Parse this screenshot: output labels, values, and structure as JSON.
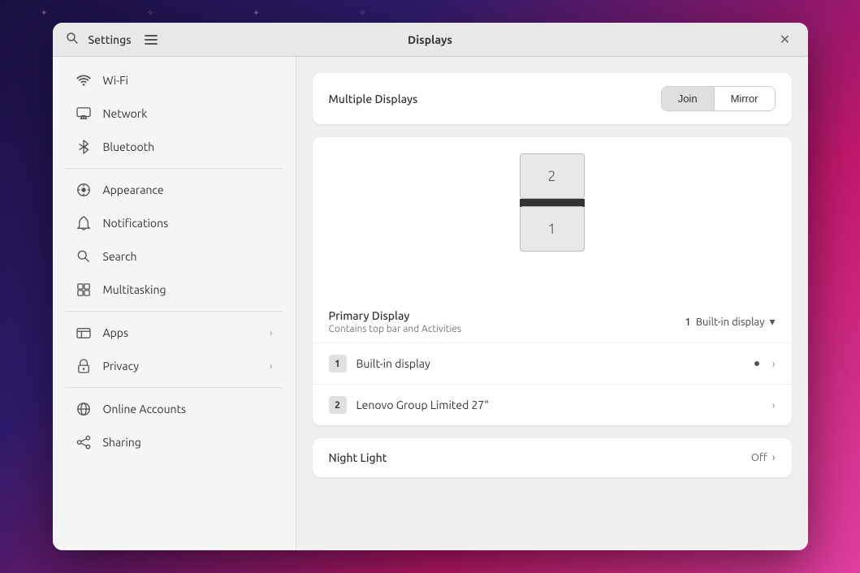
{
  "window": {
    "title": "Displays",
    "settings_label": "Settings"
  },
  "multiple_displays": {
    "label": "Multiple Displays",
    "btn_join": "Join",
    "btn_mirror": "Mirror"
  },
  "display_preview": {
    "display1_num": "1",
    "display2_num": "2"
  },
  "primary_display": {
    "title": "Primary Display",
    "subtitle": "Contains top bar and Activities",
    "monitor_num": "1",
    "display_type": "Built-in display"
  },
  "display_list": [
    {
      "num": "1",
      "name": "Built-in display"
    },
    {
      "num": "2",
      "name": "Lenovo Group Limited 27\""
    }
  ],
  "night_light": {
    "label": "Night Light",
    "status": "Off"
  },
  "sidebar": {
    "items": [
      {
        "id": "wifi",
        "label": "Wi-Fi",
        "icon": "📶",
        "has_arrow": false
      },
      {
        "id": "network",
        "label": "Network",
        "icon": "🖥",
        "has_arrow": false
      },
      {
        "id": "bluetooth",
        "label": "Bluetooth",
        "icon": "⊛",
        "has_arrow": false
      },
      {
        "id": "appearance",
        "label": "Appearance",
        "icon": "🎨",
        "has_arrow": false
      },
      {
        "id": "notifications",
        "label": "Notifications",
        "icon": "🔔",
        "has_arrow": false
      },
      {
        "id": "search",
        "label": "Search",
        "icon": "🔍",
        "has_arrow": false
      },
      {
        "id": "multitasking",
        "label": "Multitasking",
        "icon": "⊞",
        "has_arrow": false
      },
      {
        "id": "apps",
        "label": "Apps",
        "icon": "⊟",
        "has_arrow": true
      },
      {
        "id": "privacy",
        "label": "Privacy",
        "icon": "✋",
        "has_arrow": true
      },
      {
        "id": "online-accounts",
        "label": "Online Accounts",
        "icon": "🌐",
        "has_arrow": false
      },
      {
        "id": "sharing",
        "label": "Sharing",
        "icon": "↗",
        "has_arrow": false
      }
    ]
  }
}
